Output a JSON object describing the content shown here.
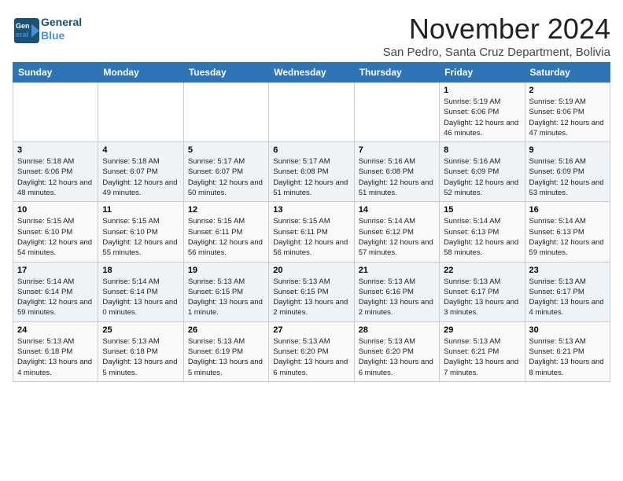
{
  "logo": {
    "line1": "General",
    "line2": "Blue"
  },
  "title": "November 2024",
  "subtitle": "San Pedro, Santa Cruz Department, Bolivia",
  "weekdays": [
    "Sunday",
    "Monday",
    "Tuesday",
    "Wednesday",
    "Thursday",
    "Friday",
    "Saturday"
  ],
  "weeks": [
    [
      {
        "day": "",
        "info": ""
      },
      {
        "day": "",
        "info": ""
      },
      {
        "day": "",
        "info": ""
      },
      {
        "day": "",
        "info": ""
      },
      {
        "day": "",
        "info": ""
      },
      {
        "day": "1",
        "info": "Sunrise: 5:19 AM\nSunset: 6:06 PM\nDaylight: 12 hours and 46 minutes."
      },
      {
        "day": "2",
        "info": "Sunrise: 5:19 AM\nSunset: 6:06 PM\nDaylight: 12 hours and 47 minutes."
      }
    ],
    [
      {
        "day": "3",
        "info": "Sunrise: 5:18 AM\nSunset: 6:06 PM\nDaylight: 12 hours and 48 minutes."
      },
      {
        "day": "4",
        "info": "Sunrise: 5:18 AM\nSunset: 6:07 PM\nDaylight: 12 hours and 49 minutes."
      },
      {
        "day": "5",
        "info": "Sunrise: 5:17 AM\nSunset: 6:07 PM\nDaylight: 12 hours and 50 minutes."
      },
      {
        "day": "6",
        "info": "Sunrise: 5:17 AM\nSunset: 6:08 PM\nDaylight: 12 hours and 51 minutes."
      },
      {
        "day": "7",
        "info": "Sunrise: 5:16 AM\nSunset: 6:08 PM\nDaylight: 12 hours and 51 minutes."
      },
      {
        "day": "8",
        "info": "Sunrise: 5:16 AM\nSunset: 6:09 PM\nDaylight: 12 hours and 52 minutes."
      },
      {
        "day": "9",
        "info": "Sunrise: 5:16 AM\nSunset: 6:09 PM\nDaylight: 12 hours and 53 minutes."
      }
    ],
    [
      {
        "day": "10",
        "info": "Sunrise: 5:15 AM\nSunset: 6:10 PM\nDaylight: 12 hours and 54 minutes."
      },
      {
        "day": "11",
        "info": "Sunrise: 5:15 AM\nSunset: 6:10 PM\nDaylight: 12 hours and 55 minutes."
      },
      {
        "day": "12",
        "info": "Sunrise: 5:15 AM\nSunset: 6:11 PM\nDaylight: 12 hours and 56 minutes."
      },
      {
        "day": "13",
        "info": "Sunrise: 5:15 AM\nSunset: 6:11 PM\nDaylight: 12 hours and 56 minutes."
      },
      {
        "day": "14",
        "info": "Sunrise: 5:14 AM\nSunset: 6:12 PM\nDaylight: 12 hours and 57 minutes."
      },
      {
        "day": "15",
        "info": "Sunrise: 5:14 AM\nSunset: 6:13 PM\nDaylight: 12 hours and 58 minutes."
      },
      {
        "day": "16",
        "info": "Sunrise: 5:14 AM\nSunset: 6:13 PM\nDaylight: 12 hours and 59 minutes."
      }
    ],
    [
      {
        "day": "17",
        "info": "Sunrise: 5:14 AM\nSunset: 6:14 PM\nDaylight: 12 hours and 59 minutes."
      },
      {
        "day": "18",
        "info": "Sunrise: 5:14 AM\nSunset: 6:14 PM\nDaylight: 13 hours and 0 minutes."
      },
      {
        "day": "19",
        "info": "Sunrise: 5:13 AM\nSunset: 6:15 PM\nDaylight: 13 hours and 1 minute."
      },
      {
        "day": "20",
        "info": "Sunrise: 5:13 AM\nSunset: 6:15 PM\nDaylight: 13 hours and 2 minutes."
      },
      {
        "day": "21",
        "info": "Sunrise: 5:13 AM\nSunset: 6:16 PM\nDaylight: 13 hours and 2 minutes."
      },
      {
        "day": "22",
        "info": "Sunrise: 5:13 AM\nSunset: 6:17 PM\nDaylight: 13 hours and 3 minutes."
      },
      {
        "day": "23",
        "info": "Sunrise: 5:13 AM\nSunset: 6:17 PM\nDaylight: 13 hours and 4 minutes."
      }
    ],
    [
      {
        "day": "24",
        "info": "Sunrise: 5:13 AM\nSunset: 6:18 PM\nDaylight: 13 hours and 4 minutes."
      },
      {
        "day": "25",
        "info": "Sunrise: 5:13 AM\nSunset: 6:18 PM\nDaylight: 13 hours and 5 minutes."
      },
      {
        "day": "26",
        "info": "Sunrise: 5:13 AM\nSunset: 6:19 PM\nDaylight: 13 hours and 5 minutes."
      },
      {
        "day": "27",
        "info": "Sunrise: 5:13 AM\nSunset: 6:20 PM\nDaylight: 13 hours and 6 minutes."
      },
      {
        "day": "28",
        "info": "Sunrise: 5:13 AM\nSunset: 6:20 PM\nDaylight: 13 hours and 6 minutes."
      },
      {
        "day": "29",
        "info": "Sunrise: 5:13 AM\nSunset: 6:21 PM\nDaylight: 13 hours and 7 minutes."
      },
      {
        "day": "30",
        "info": "Sunrise: 5:13 AM\nSunset: 6:21 PM\nDaylight: 13 hours and 8 minutes."
      }
    ]
  ]
}
